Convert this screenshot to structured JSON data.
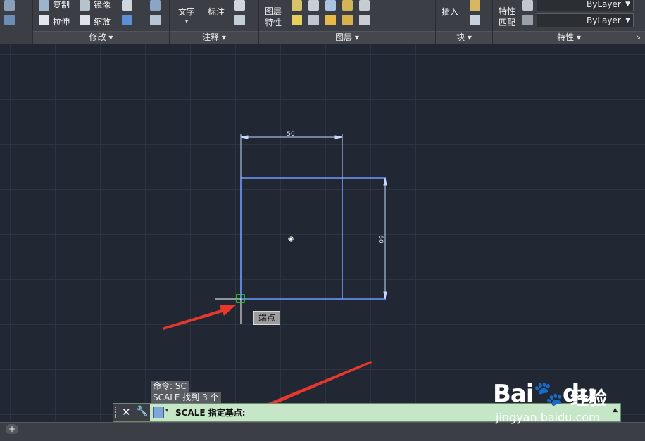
{
  "ribbon": {
    "modify": {
      "copy": "复制",
      "mirror": "镜像",
      "stretch": "拉伸",
      "scale": "缩放",
      "title": "修改"
    },
    "annotation": {
      "text": "文字",
      "dimension": "标注",
      "title": "注释"
    },
    "layers": {
      "layer_props_line1": "图层",
      "layer_props_line2": "特性",
      "title": "图层"
    },
    "block": {
      "insert": "插入",
      "title": "块"
    },
    "properties": {
      "match_line1": "特性",
      "match_line2": "匹配",
      "linetype": "ByLayer",
      "lineweight": "ByLayer",
      "title": "特性"
    }
  },
  "drawing": {
    "dim_width": "50",
    "dim_height": "60",
    "snap_tooltip": "端点"
  },
  "command": {
    "history": [
      "命令: SC",
      "SCALE 找到 3 个"
    ],
    "prompt": "SCALE 指定基点:"
  },
  "watermark": {
    "logo": "Bai",
    "logo2": "du",
    "cn": "经验",
    "url": "jingyan.baidu.com"
  },
  "colors": {
    "geometry": "#6f9bff",
    "grid": "#2c3442",
    "annotation_arrow": "#e8372c"
  }
}
